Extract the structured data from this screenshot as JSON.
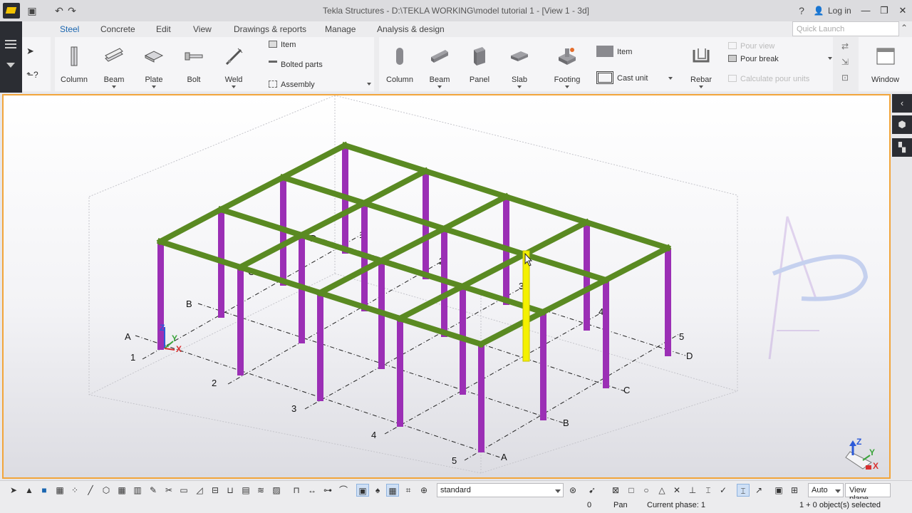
{
  "titlebar": {
    "title": "Tekla Structures - D:\\TEKLA WORKING\\model tutorial 1  - [View 1 - 3d]",
    "help": "?",
    "login": "Log in"
  },
  "ribbon": {
    "tabs": [
      "Steel",
      "Concrete",
      "Edit",
      "View",
      "Drawings & reports",
      "Manage",
      "Analysis & design"
    ],
    "active_tab": "Steel",
    "quick_launch_placeholder": "Quick Launch",
    "steel_tools": [
      "Column",
      "Beam",
      "Plate",
      "Bolt",
      "Weld"
    ],
    "steel_small": [
      "Item",
      "Bolted parts",
      "Assembly"
    ],
    "concrete_tools": [
      "Column",
      "Beam",
      "Panel",
      "Slab",
      "Footing"
    ],
    "concrete_small": [
      "Item",
      "Cast unit"
    ],
    "rebar": "Rebar",
    "pour_tools": [
      "Pour view",
      "Pour break",
      "Calculate pour units"
    ],
    "window": "Window"
  },
  "model": {
    "grid_letters_front": [
      "A",
      "B",
      "C",
      "D"
    ],
    "grid_numbers_front": [
      "1",
      "2",
      "3",
      "4",
      "5"
    ],
    "axis_labels": [
      "Z",
      "Y",
      "X"
    ],
    "colors": {
      "beam": "#5a8a22",
      "column": "#9b2fb5",
      "selected": "#f4f000",
      "highlight": "#f2a53b"
    }
  },
  "bottom": {
    "filter": "standard",
    "auto": "Auto",
    "view_plane": "View plane"
  },
  "status": {
    "coord": "0",
    "mode": "Pan",
    "phase": "Current phase: 1",
    "selection": "1 + 0 object(s) selected"
  }
}
